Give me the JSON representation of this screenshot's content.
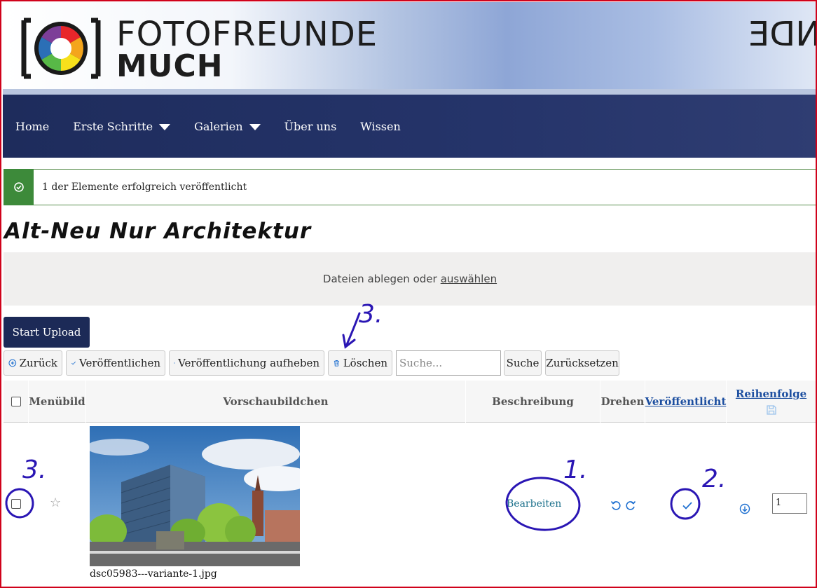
{
  "header": {
    "logo_line1": "FOTOFREUNDE",
    "logo_line2": "MUCH",
    "logo_mirror": "NDE"
  },
  "nav": {
    "items": [
      {
        "label": "Home",
        "has_dropdown": false
      },
      {
        "label": "Erste Schritte",
        "has_dropdown": true
      },
      {
        "label": "Galerien",
        "has_dropdown": true
      },
      {
        "label": "Über uns",
        "has_dropdown": false
      },
      {
        "label": "Wissen",
        "has_dropdown": false
      }
    ]
  },
  "alert": {
    "text": "1 der Elemente erfolgreich veröffentlicht",
    "icon": "check-circle-icon",
    "color": "#3d8a3a"
  },
  "page_title": "Alt-Neu Nur Architektur",
  "dropzone": {
    "text": "Dateien ablegen oder",
    "link": "auswählen"
  },
  "upload_button": "Start Upload",
  "toolbar": {
    "back": "Zurück",
    "publish": "Veröffentlichen",
    "unpublish": "Veröffentlichung aufheben",
    "delete": "Löschen",
    "search_placeholder": "Suche...",
    "search": "Suche",
    "reset": "Zurücksetzen"
  },
  "table": {
    "headers": {
      "menu_image": "Menübild",
      "thumbnail": "Vorschaubildchen",
      "description": "Beschreibung",
      "rotate": "Drehen",
      "published": "Veröffentlicht",
      "order": "Reihenfolge"
    },
    "rows": [
      {
        "filename": "dsc05983---variante-1.jpg",
        "edit_label": "Bearbeiten",
        "published": true,
        "order": "1"
      }
    ]
  },
  "annotations": {
    "a1": "1.",
    "a2": "2.",
    "a3_top": "3.",
    "a3_row": "3."
  },
  "colors": {
    "nav": "#1e2c5c",
    "accent_blue": "#1d4fa0",
    "annotation": "#2a16b4",
    "success": "#3d8a3a"
  }
}
